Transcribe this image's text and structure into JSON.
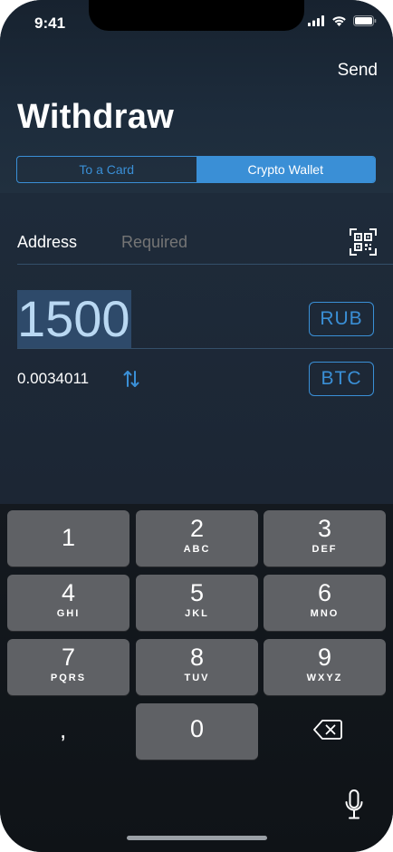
{
  "status_bar": {
    "time": "9:41"
  },
  "header": {
    "send_label": "Send",
    "title": "Withdraw",
    "tabs": [
      {
        "label": "To a Card",
        "active": false
      },
      {
        "label": "Crypto Wallet",
        "active": true
      }
    ]
  },
  "form": {
    "address_label": "Address",
    "address_placeholder": "Required",
    "amount": "1500",
    "primary_currency": "RUB",
    "converted_amount": "0.0034011",
    "secondary_currency": "BTC"
  },
  "keyboard": {
    "keys": [
      {
        "num": "1",
        "letters": ""
      },
      {
        "num": "2",
        "letters": "ABC"
      },
      {
        "num": "3",
        "letters": "DEF"
      },
      {
        "num": "4",
        "letters": "GHI"
      },
      {
        "num": "5",
        "letters": "JKL"
      },
      {
        "num": "6",
        "letters": "MNO"
      },
      {
        "num": "7",
        "letters": "PQRS"
      },
      {
        "num": "8",
        "letters": "TUV"
      },
      {
        "num": "9",
        "letters": "WXYZ"
      }
    ],
    "zero": "0",
    "comma": ","
  },
  "colors": {
    "accent": "#3a8fd6",
    "background": "#1b2836",
    "key": "#5f6165"
  }
}
